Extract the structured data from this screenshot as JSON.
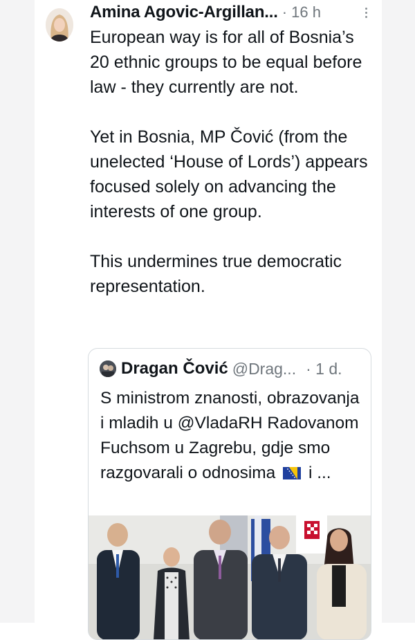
{
  "tweet": {
    "author_name": "Amina Agovic-Argillan...",
    "time": "· 16 h",
    "paragraphs": [
      "European way is for all of Bosnia’s 20 ethnic groups to be equal before law - they currently are not.",
      "Yet in Bosnia, MP Čović (from the unelected ‘House of Lords’) appears focused solely on advancing the interests of one group.",
      "This undermines true democratic representation."
    ]
  },
  "quote": {
    "author_name": "Dragan Čović",
    "handle": "@Drag...",
    "time": "· 1 d.",
    "text_before_flag": "S ministrom znanosti, obrazovanja i mladih u @VladaRH Radovanom Fuchsom u Zagrebu, gdje smo razgovarali o odnosima",
    "text_after_flag": "i ..."
  },
  "icons": {
    "more": "more-vertical-icon",
    "flag": "bosnia-flag-emoji"
  },
  "colors": {
    "text": "#0f1419",
    "secondary": "#6f767c",
    "border": "#d6dbdf",
    "gutter": "#f4f4f5"
  }
}
